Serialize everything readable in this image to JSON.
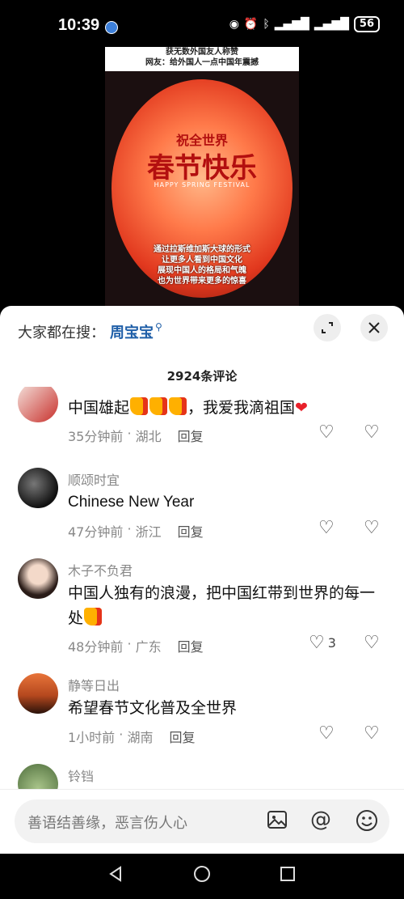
{
  "status": {
    "time": "10:39",
    "icons": [
      "eye-icon",
      "alarm-icon",
      "bluetooth-icon",
      "signal-5g-icon",
      "signal-4g-icon"
    ],
    "battery": "56"
  },
  "video": {
    "header_line1": "获无数外国友人称赞",
    "header_line2": "网友：给外国人一点中国年震撼",
    "globe_small": "祝全世界",
    "globe_big": "春节快乐",
    "globe_en": "HAPPY SPRING FESTIVAL",
    "caption": [
      "通过拉斯维加斯大球的形式",
      "让更多人看到中国文化",
      "展现中国人的格局和气魄",
      "也为世界带来更多的惊喜"
    ]
  },
  "panel": {
    "search_label": "大家都在搜：",
    "search_term": "周宝宝",
    "comment_count": "2924条评论"
  },
  "comments": [
    {
      "username": "",
      "text": "中国雄起",
      "text_after": "，我爱我滴祖国",
      "time": "35分钟前",
      "location": "湖北",
      "reply": "回复",
      "likes": "",
      "avatar_color": "#c8302c"
    },
    {
      "username": "顺颂时宜",
      "text": "Chinese New Year",
      "time": "47分钟前",
      "location": "浙江",
      "reply": "回复",
      "likes": "",
      "avatar_color": "#111111"
    },
    {
      "username": "木子不负君",
      "text": "中国人独有的浪漫，把中国红带到世界的每一处",
      "time": "48分钟前",
      "location": "广东",
      "reply": "回复",
      "likes": "3",
      "avatar_color": "#d9b9a0"
    },
    {
      "username": "静等日出",
      "text": "希望春节文化普及全世界",
      "time": "1小时前",
      "location": "湖南",
      "reply": "回复",
      "likes": "",
      "avatar_color": "#b5481e"
    },
    {
      "username": "铃铛",
      "text": "",
      "time": "",
      "location": "",
      "reply": "",
      "likes": "",
      "avatar_color": "#6d8c5a"
    }
  ],
  "input": {
    "placeholder": "善语结善缘，恶言伤人心",
    "icons": [
      "image-icon",
      "mention-icon",
      "emoji-icon"
    ]
  },
  "colors": {
    "accent": "#1f5fa8",
    "like_heart": "#e8202a"
  }
}
